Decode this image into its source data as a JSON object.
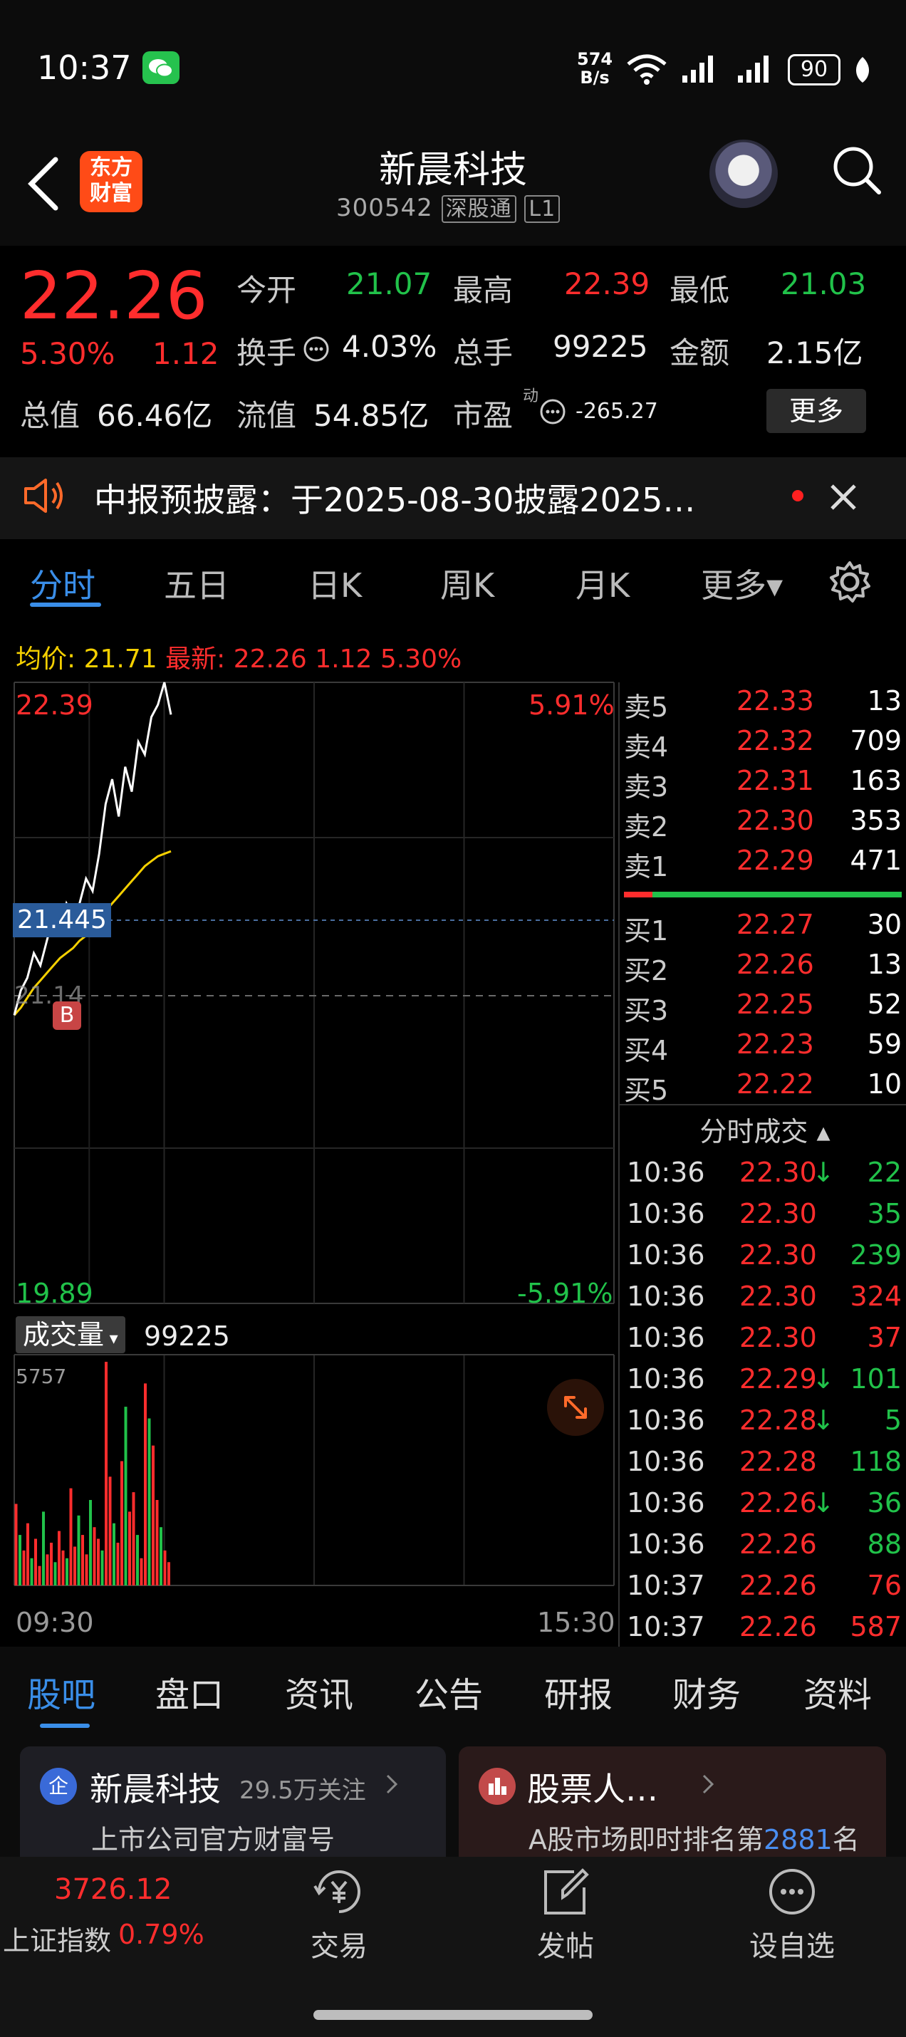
{
  "status_bar": {
    "time": "10:37",
    "net_speed_value": "574",
    "net_speed_unit": "B/s",
    "battery": "90"
  },
  "header": {
    "logo_line1": "东方",
    "logo_line2": "财富",
    "stock_name": "新晨科技",
    "stock_code": "300542",
    "tag_connect": "深股通",
    "tag_level": "L1"
  },
  "quote": {
    "price": "22.26",
    "change_pct": "5.30%",
    "change": "1.12",
    "open_label": "今开",
    "open": "21.07",
    "high_label": "最高",
    "high": "22.39",
    "low_label": "最低",
    "low": "21.03",
    "turnover_label": "换手",
    "turnover": "4.03%",
    "volume_label": "总手",
    "volume": "99225",
    "amount_label": "金额",
    "amount": "2.15亿",
    "mktcap_label": "总值",
    "mktcap": "66.46亿",
    "float_label": "流值",
    "float": "54.85亿",
    "pe_label": "市盈",
    "pe_sup": "动",
    "pe": "-265.27",
    "more_button": "更多"
  },
  "notice": {
    "text": "中报预披露：于2025-08-30披露2025…"
  },
  "chart_tabs": [
    "分时",
    "五日",
    "日K",
    "周K",
    "月K",
    "更多▾"
  ],
  "info_line": {
    "avg_label": "均价:",
    "avg": "21.71",
    "latest_label": "最新:",
    "latest": "22.26",
    "latest_chg": "1.12",
    "latest_pct": "5.30%"
  },
  "chart_labels": {
    "top_price": "22.39",
    "top_pct": "5.91%",
    "bottom_price": "19.89",
    "bottom_pct": "-5.91%",
    "crosshair_price": "21.445",
    "prev_close": "21.14",
    "buy_marker": "B",
    "volume_selector": "成交量",
    "volume_value": "99225",
    "volume_max": "5757",
    "time_start": "09:30",
    "time_end": "15:30"
  },
  "chart_data": {
    "type": "line",
    "ylim": [
      19.89,
      22.39
    ],
    "prev_close": 21.14,
    "series": [
      {
        "values": [
          21.05,
          21.15,
          21.2,
          21.3,
          21.25,
          21.35,
          21.45,
          21.4,
          21.5,
          21.45,
          21.5,
          21.6,
          21.55,
          21.7,
          21.9,
          22.0,
          21.85,
          22.05,
          21.95,
          22.15,
          22.1,
          22.25,
          22.3,
          22.39,
          22.26
        ]
      },
      {
        "values": [
          21.05,
          21.08,
          21.12,
          21.16,
          21.19,
          21.22,
          21.25,
          21.28,
          21.3,
          21.32,
          21.35,
          21.37,
          21.4,
          21.43,
          21.47,
          21.5,
          21.53,
          21.56,
          21.59,
          21.62,
          21.65,
          21.67,
          21.69,
          21.7,
          21.71
        ]
      }
    ],
    "volume": [
      2100,
      1300,
      900,
      1600,
      700,
      1200,
      500,
      1900,
      800,
      1100,
      600,
      1400,
      900,
      700,
      2500,
      1000,
      1800,
      1300,
      800,
      2200,
      1500,
      1200,
      900,
      5757,
      2800,
      1600,
      1100,
      3200,
      4600,
      1900,
      2400,
      1300,
      700,
      5200,
      4300,
      3600,
      2200,
      1500,
      900,
      600
    ]
  },
  "order_book": {
    "asks": [
      {
        "label": "卖5",
        "price": "22.33",
        "vol": "13"
      },
      {
        "label": "卖4",
        "price": "22.32",
        "vol": "709"
      },
      {
        "label": "卖3",
        "price": "22.31",
        "vol": "163"
      },
      {
        "label": "卖2",
        "price": "22.30",
        "vol": "353"
      },
      {
        "label": "卖1",
        "price": "22.29",
        "vol": "471"
      }
    ],
    "bids": [
      {
        "label": "买1",
        "price": "22.27",
        "vol": "30"
      },
      {
        "label": "买2",
        "price": "22.26",
        "vol": "13"
      },
      {
        "label": "买3",
        "price": "22.25",
        "vol": "52"
      },
      {
        "label": "买4",
        "price": "22.23",
        "vol": "59"
      },
      {
        "label": "买5",
        "price": "22.22",
        "vol": "10"
      }
    ]
  },
  "trades": {
    "title": "分时成交 ▴",
    "rows": [
      {
        "time": "10:36",
        "price": "22.30",
        "arrow": "↓",
        "vol": "22",
        "side": "sell"
      },
      {
        "time": "10:36",
        "price": "22.30",
        "arrow": "",
        "vol": "35",
        "side": "sell"
      },
      {
        "time": "10:36",
        "price": "22.30",
        "arrow": "",
        "vol": "239",
        "side": "sell"
      },
      {
        "time": "10:36",
        "price": "22.30",
        "arrow": "",
        "vol": "324",
        "side": "buy"
      },
      {
        "time": "10:36",
        "price": "22.30",
        "arrow": "",
        "vol": "37",
        "side": "buy"
      },
      {
        "time": "10:36",
        "price": "22.29",
        "arrow": "↓",
        "vol": "101",
        "side": "sell"
      },
      {
        "time": "10:36",
        "price": "22.28",
        "arrow": "↓",
        "vol": "5",
        "side": "sell"
      },
      {
        "time": "10:36",
        "price": "22.28",
        "arrow": "",
        "vol": "118",
        "side": "sell"
      },
      {
        "time": "10:36",
        "price": "22.26",
        "arrow": "↓",
        "vol": "36",
        "side": "sell"
      },
      {
        "time": "10:36",
        "price": "22.26",
        "arrow": "",
        "vol": "88",
        "side": "sell"
      },
      {
        "time": "10:37",
        "price": "22.26",
        "arrow": "",
        "vol": "76",
        "side": "buy"
      },
      {
        "time": "10:37",
        "price": "22.26",
        "arrow": "",
        "vol": "587",
        "side": "buy"
      }
    ]
  },
  "section_tabs": [
    "股吧",
    "盘口",
    "资讯",
    "公告",
    "研报",
    "财务",
    "资料"
  ],
  "cards": {
    "left_badge": "企",
    "left_title": "新晨科技",
    "left_followers": "29.5万关注",
    "left_subtitle": "上市公司官方财富号",
    "right_title": "股票人…",
    "right_sub_prefix": "A股市场即时排名第",
    "right_rank": "2881",
    "right_sub_suffix": "名"
  },
  "bottom_bar": {
    "index_value": "3726.12",
    "index_name": "上证指数",
    "index_pct": "0.79%",
    "trade": "交易",
    "post": "发帖",
    "watch": "设自选"
  },
  "colors": {
    "up": "#ff2d2d",
    "down": "#21c24a",
    "accent": "#3a8ee8",
    "avg_line": "#f5d000"
  }
}
